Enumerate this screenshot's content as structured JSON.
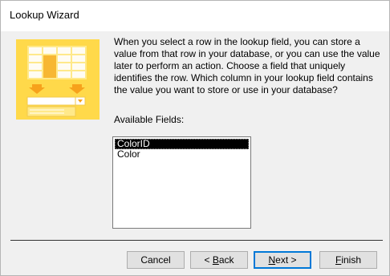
{
  "window": {
    "title": "Lookup Wizard"
  },
  "description": "When you select a row in the lookup field, you can store a value from that row in your database, or you can use the value later to perform an action.  Choose a field that uniquely identifies the row. Which column in your lookup field contains the value you want to store or use in your database?",
  "fields": {
    "label": "Available Fields:",
    "items": [
      "ColorID",
      "Color"
    ],
    "selected_index": 0
  },
  "buttons": {
    "cancel": "Cancel",
    "back_pre": "< ",
    "back_key": "B",
    "back_post": "ack",
    "next_key": "N",
    "next_post": "ext >",
    "finish_key": "F",
    "finish_post": "inish"
  },
  "colors": {
    "illustration_bg": "#ffd94a",
    "selection_bg": "#000000",
    "default_button_border": "#0078d7"
  }
}
